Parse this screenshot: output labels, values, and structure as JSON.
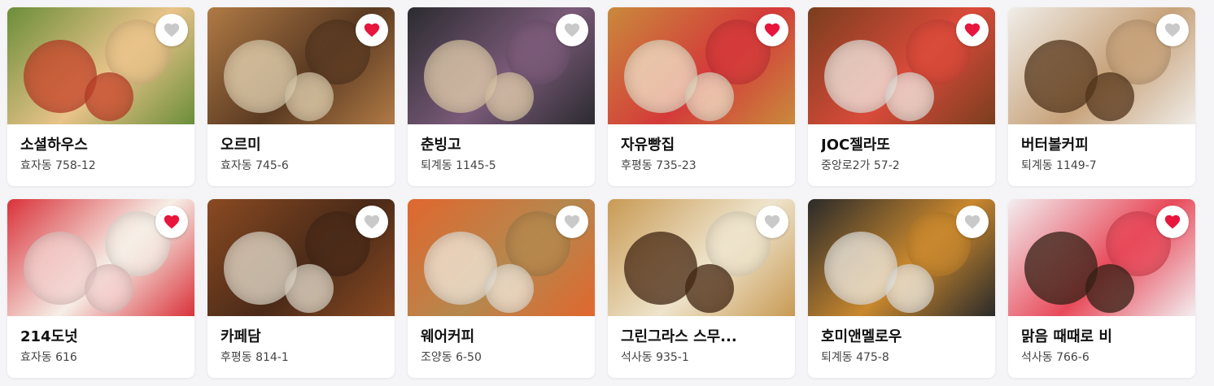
{
  "colors": {
    "heart_active": "#e8163c",
    "heart_inactive": "#c9c9c9",
    "page_background": "#f5f5f7"
  },
  "cards": [
    {
      "name": "소셜하우스",
      "address": "효자동 758-12",
      "favorited": false,
      "photo_icon": "salad-bacon-photo",
      "bg": [
        "#6b8e3a",
        "#c8432a",
        "#e9c38a"
      ]
    },
    {
      "name": "오르미",
      "address": "효자동 745-6",
      "favorited": true,
      "photo_icon": "pastry-display-photo",
      "bg": [
        "#b07a45",
        "#e9d9b8",
        "#5a3a22"
      ]
    },
    {
      "name": "춘빙고",
      "address": "퇴계동 1145-5",
      "favorited": false,
      "photo_icon": "bingsu-photo",
      "bg": [
        "#2b2b30",
        "#e8d3b0",
        "#7a5a78"
      ]
    },
    {
      "name": "자유빵집",
      "address": "후평동 735-23",
      "favorited": true,
      "photo_icon": "strawberry-croissant-photo",
      "bg": [
        "#c98a3c",
        "#f2e7cf",
        "#d43a3a"
      ]
    },
    {
      "name": "JOC젤라또",
      "address": "중앙로2가 57-2",
      "favorited": true,
      "photo_icon": "gelato-cup-photo",
      "bg": [
        "#7a3e1e",
        "#f3efe8",
        "#d94a3a"
      ]
    },
    {
      "name": "버터볼커피",
      "address": "퇴계동 1149-7",
      "favorited": false,
      "photo_icon": "coffee-cake-photo",
      "bg": [
        "#f0ede8",
        "#5b3a1e",
        "#c7a27a"
      ]
    },
    {
      "name": "214도넛",
      "address": "효자동 616",
      "favorited": true,
      "photo_icon": "donut-milkshake-photo",
      "bg": [
        "#d9323a",
        "#f4d3d0",
        "#f6efe7"
      ]
    },
    {
      "name": "카페담",
      "address": "후평동 814-1",
      "favorited": false,
      "photo_icon": "dessert-tray-photo",
      "bg": [
        "#8a4a22",
        "#eae2d2",
        "#4a2a18"
      ]
    },
    {
      "name": "웨어커피",
      "address": "조양동 6-50",
      "favorited": false,
      "photo_icon": "bread-coffee-photo",
      "bg": [
        "#e0672e",
        "#f3ece0",
        "#b5884e"
      ]
    },
    {
      "name": "그린그라스 스무...",
      "address": "석사동 935-1",
      "favorited": false,
      "photo_icon": "iced-coffee-photo",
      "bg": [
        "#c89a54",
        "#4a2a14",
        "#eee4cc"
      ]
    },
    {
      "name": "호미앤멜로우",
      "address": "퇴계동 475-8",
      "favorited": false,
      "photo_icon": "creme-brulee-photo",
      "bg": [
        "#2a2a2a",
        "#f2efe8",
        "#c9882e"
      ]
    },
    {
      "name": "맑음 때때로 비",
      "address": "석사동 766-6",
      "favorited": true,
      "photo_icon": "chocolate-cake-photo",
      "bg": [
        "#f2eef0",
        "#3a2418",
        "#e84a5a"
      ]
    }
  ]
}
